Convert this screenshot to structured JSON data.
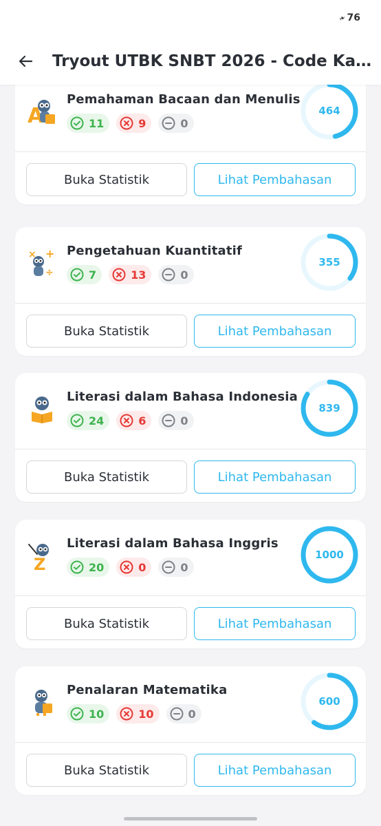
{
  "status_bar": {
    "battery": "76"
  },
  "header": {
    "title": "Tryout UTBK SNBT 2026 - Code Kan..."
  },
  "buttons": {
    "stats_label": "Buka Statistik",
    "review_label": "Lihat Pembahasan"
  },
  "colors": {
    "accent": "#2fb8ee",
    "correct": "#3fb34f",
    "wrong": "#e53935",
    "empty": "#7d8187"
  },
  "score_scale_max": 1000,
  "subjects": [
    {
      "name": "Pemahaman Bacaan dan Menulis",
      "correct": "11",
      "wrong": "9",
      "empty": "0",
      "score": "464",
      "icon": "owl-letters-icon"
    },
    {
      "name": "Pengetahuan Kuantitatif",
      "correct": "7",
      "wrong": "13",
      "empty": "0",
      "score": "355",
      "icon": "owl-math-icon"
    },
    {
      "name": "Literasi dalam Bahasa Indonesia",
      "correct": "24",
      "wrong": "6",
      "empty": "0",
      "score": "839",
      "icon": "owl-book-icon"
    },
    {
      "name": "Literasi dalam Bahasa Inggris",
      "correct": "20",
      "wrong": "0",
      "empty": "0",
      "score": "1000",
      "icon": "owl-teacher-icon"
    },
    {
      "name": "Penalaran Matematika",
      "correct": "10",
      "wrong": "10",
      "empty": "0",
      "score": "600",
      "icon": "owl-reading-icon"
    }
  ]
}
